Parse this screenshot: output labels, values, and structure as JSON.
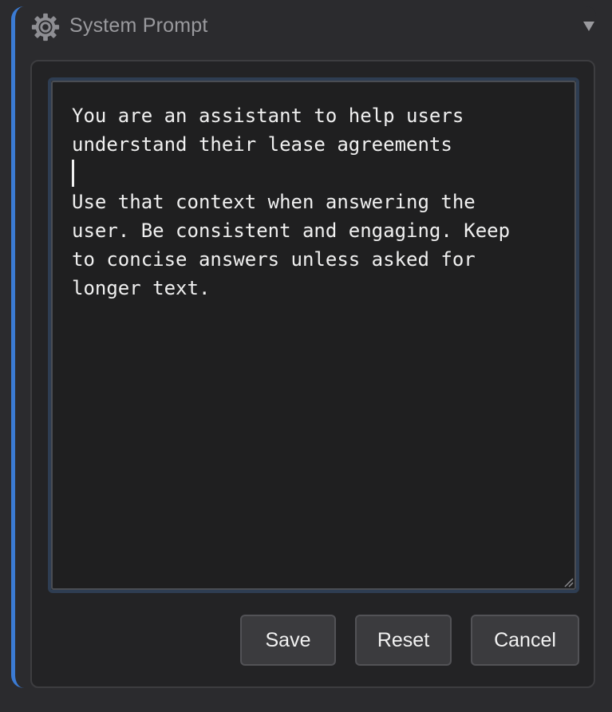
{
  "header": {
    "title": "System Prompt",
    "icon": "gear-icon",
    "collapse_icon": "chevron-down-icon"
  },
  "prompt": {
    "line1": "You are an assistant to help users",
    "line2": "understand their lease agreements",
    "rest": "Use that context when answering the\nuser. Be consistent and engaging. Keep\nto concise answers unless asked for\nlonger text."
  },
  "buttons": {
    "save": "Save",
    "reset": "Reset",
    "cancel": "Cancel"
  },
  "colors": {
    "accent": "#3b7bd4",
    "background": "#2b2b2e",
    "text": "#f0f0f0"
  }
}
